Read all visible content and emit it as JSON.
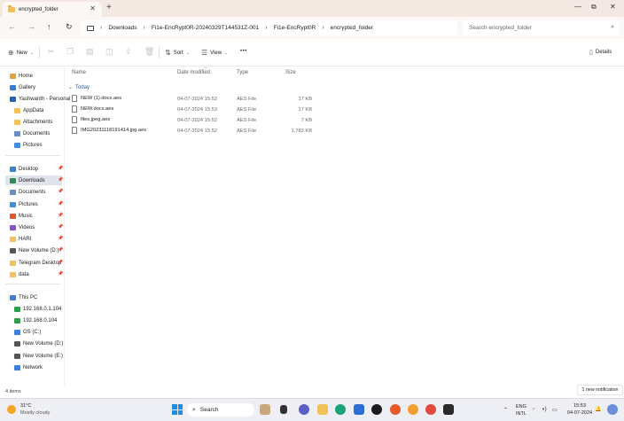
{
  "tab": {
    "title": "encrypted_folder"
  },
  "window_controls": {
    "minimize": "—",
    "maximize": "⧉",
    "close": "✕"
  },
  "nav": {
    "back": "←",
    "forward": "→",
    "up": "↑",
    "refresh": "↻"
  },
  "breadcrumb": [
    "Downloads",
    "Fi1e-EncRypt0R-20240329T144531Z-001",
    "Fi1e-EncRypt0R",
    "encrypted_folder"
  ],
  "search": {
    "placeholder": "Search encrypted_folder"
  },
  "commands": {
    "new": "New",
    "sort": "Sort",
    "view": "View",
    "more": "•••",
    "details": "Details"
  },
  "sidebar": {
    "top": [
      {
        "label": "Home",
        "icon": "home-icon",
        "color": "#e8a23a"
      },
      {
        "label": "Gallery",
        "icon": "gallery-icon",
        "color": "#2f7fd8"
      },
      {
        "label": "Yashwanth - Personal",
        "icon": "onedrive-icon",
        "color": "#2463b8"
      },
      {
        "label": "AppData",
        "icon": "folder-icon",
        "color": "#f2c25a"
      },
      {
        "label": "Attachments",
        "icon": "folder-icon",
        "color": "#f2c25a"
      },
      {
        "label": "Documents",
        "icon": "documents-icon",
        "color": "#6b8cc7"
      },
      {
        "label": "Pictures",
        "icon": "pictures-icon",
        "color": "#3f8fe0"
      }
    ],
    "quick": [
      {
        "label": "Desktop",
        "icon": "desktop-icon",
        "color": "#3b82d6"
      },
      {
        "label": "Downloads",
        "icon": "downloads-icon",
        "color": "#2e8b57",
        "selected": true
      },
      {
        "label": "Documents",
        "icon": "documents-icon",
        "color": "#6b8cc7"
      },
      {
        "label": "Pictures",
        "icon": "pictures-icon",
        "color": "#3f8fe0"
      },
      {
        "label": "Music",
        "icon": "music-icon",
        "color": "#e0562e"
      },
      {
        "label": "Videos",
        "icon": "videos-icon",
        "color": "#8a4fd4"
      },
      {
        "label": "HARI",
        "icon": "folder-icon",
        "color": "#f2c25a"
      },
      {
        "label": "New Volume (D:)",
        "icon": "drive-icon",
        "color": "#555555"
      },
      {
        "label": "Telegram Desktop",
        "icon": "folder-icon",
        "color": "#f2c25a"
      },
      {
        "label": "data",
        "icon": "folder-icon",
        "color": "#f2c25a"
      }
    ],
    "pc": [
      {
        "label": "This PC",
        "icon": "pc-icon",
        "color": "#3b82d6"
      },
      {
        "label": "192.168.0.1.104",
        "icon": "network-drive-icon",
        "color": "#2e9e4e"
      },
      {
        "label": "192.168.0.104",
        "icon": "network-drive-icon",
        "color": "#2e9e4e"
      },
      {
        "label": "OS (C:)",
        "icon": "drive-icon",
        "color": "#3b82d6"
      },
      {
        "label": "New Volume (D:)",
        "icon": "drive-icon",
        "color": "#555555"
      },
      {
        "label": "New Volume (E:)",
        "icon": "drive-icon",
        "color": "#555555"
      },
      {
        "label": "Network",
        "icon": "network-icon",
        "color": "#3b82d6"
      }
    ]
  },
  "columns": {
    "name": "Name",
    "date": "Date modified",
    "type": "Type",
    "size": "Size"
  },
  "group_label": "Today",
  "files": [
    {
      "name": "NEW (1).docx.aes",
      "date": "04-07-2024 15:53",
      "type": "AES File",
      "size": "17 KB"
    },
    {
      "name": "NEW.docx.aes",
      "date": "04-07-2024 15:53",
      "type": "AES File",
      "size": "17 KB"
    },
    {
      "name": "files.jpeg.aes",
      "date": "04-07-2024 15:52",
      "type": "AES File",
      "size": "7 KB"
    },
    {
      "name": "IMG20231118191414.jpg.aes",
      "date": "04-07-2024 15:52",
      "type": "AES File",
      "size": "1,783 KB"
    }
  ],
  "status": {
    "items": "4 items"
  },
  "notification": "1 new notification",
  "taskbar": {
    "temp": "31°C",
    "condition": "Mostly cloudy",
    "search": "Search",
    "lang": "ENG",
    "region": "INTL",
    "time": "15:53",
    "date": "04-07-2024"
  }
}
